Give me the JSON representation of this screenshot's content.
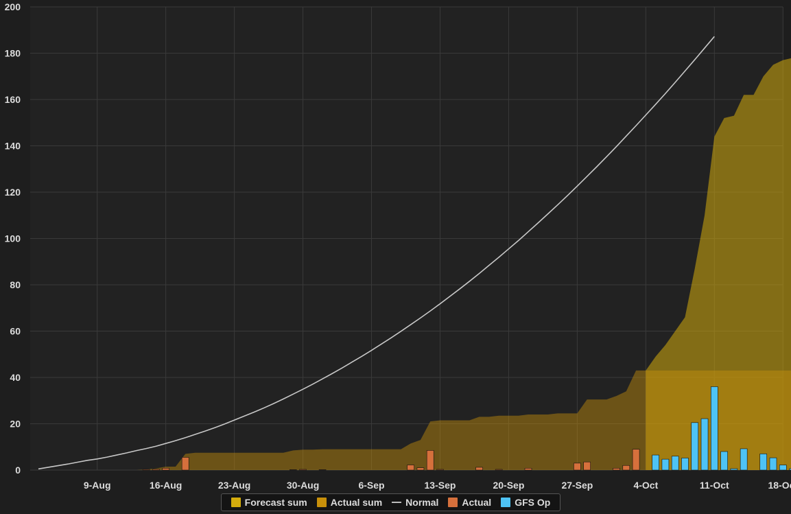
{
  "chart_data": {
    "type": "bar+area+line",
    "x_dates": [
      "Aug 3",
      "Aug 4",
      "Aug 5",
      "Aug 6",
      "Aug 7",
      "Aug 8",
      "Aug 9",
      "Aug 10",
      "Aug 11",
      "Aug 12",
      "Aug 13",
      "Aug 14",
      "Aug 15",
      "Aug 16",
      "Aug 17",
      "Aug 18",
      "Aug 19",
      "Aug 20",
      "Aug 21",
      "Aug 22",
      "Aug 23",
      "Aug 24",
      "Aug 25",
      "Aug 26",
      "Aug 27",
      "Aug 28",
      "Aug 29",
      "Aug 30",
      "Aug 31",
      "Sep 1",
      "Sep 2",
      "Sep 3",
      "Sep 4",
      "Sep 5",
      "Sep 6",
      "Sep 7",
      "Sep 8",
      "Sep 9",
      "Sep 10",
      "Sep 11",
      "Sep 12",
      "Sep 13",
      "Sep 14",
      "Sep 15",
      "Sep 16",
      "Sep 17",
      "Sep 18",
      "Sep 19",
      "Sep 20",
      "Sep 21",
      "Sep 22",
      "Sep 23",
      "Sep 24",
      "Sep 25",
      "Sep 26",
      "Sep 27",
      "Sep 28",
      "Sep 29",
      "Sep 30",
      "Oct 1",
      "Oct 2",
      "Oct 3",
      "Oct 4",
      "Oct 5",
      "Oct 6",
      "Oct 7",
      "Oct 8",
      "Oct 9",
      "Oct 10",
      "Oct 11",
      "Oct 12",
      "Oct 13",
      "Oct 14",
      "Oct 15",
      "Oct 16",
      "Oct 17",
      "Oct 18",
      "Oct 19"
    ],
    "x_tick_labels": [
      "9-Aug",
      "16-Aug",
      "23-Aug",
      "30-Aug",
      "6-Sep",
      "13-Sep",
      "20-Sep",
      "27-Sep",
      "4-Oct",
      "11-Oct",
      "18-Oct"
    ],
    "y_ticks": [
      0,
      20,
      40,
      60,
      80,
      100,
      120,
      140,
      160,
      180,
      200
    ],
    "ylim": [
      0,
      200
    ],
    "grid": true,
    "legend_position": "bottom-center",
    "series": [
      {
        "name": "Forecast sum",
        "kind": "area",
        "color": "#d4ac0d",
        "values": [
          null,
          null,
          null,
          null,
          null,
          null,
          null,
          null,
          null,
          null,
          null,
          null,
          null,
          null,
          null,
          null,
          null,
          null,
          null,
          null,
          null,
          null,
          null,
          null,
          null,
          null,
          null,
          null,
          null,
          null,
          null,
          null,
          null,
          null,
          null,
          null,
          null,
          null,
          null,
          null,
          null,
          null,
          null,
          null,
          null,
          null,
          null,
          null,
          null,
          null,
          null,
          null,
          null,
          null,
          null,
          null,
          null,
          null,
          null,
          null,
          null,
          null,
          43,
          49,
          54,
          60,
          66,
          87,
          110,
          144,
          152,
          153,
          162,
          162,
          170,
          175,
          177,
          178
        ]
      },
      {
        "name": "Actual sum",
        "kind": "area",
        "color": "#c8900a",
        "values": [
          0,
          0,
          0,
          0,
          0,
          0,
          0,
          0,
          0,
          0,
          0,
          0.3,
          0.7,
          1.5,
          1.5,
          7,
          7.5,
          7.5,
          7.5,
          7.5,
          7.5,
          7.5,
          7.5,
          7.5,
          7.5,
          7.5,
          8.5,
          8.8,
          8.8,
          9,
          9,
          9,
          9,
          9,
          9,
          9,
          9,
          9,
          11.5,
          13,
          21,
          21.5,
          21.5,
          21.5,
          21.5,
          23,
          23,
          23.5,
          23.5,
          23.5,
          24,
          24,
          24,
          24.5,
          24.5,
          24.5,
          30.5,
          30.5,
          30.5,
          32,
          34,
          43,
          43,
          43,
          43,
          43,
          43,
          43,
          43,
          43,
          43,
          43,
          43,
          43,
          43,
          43,
          43,
          43
        ]
      },
      {
        "name": "Normal",
        "kind": "line",
        "color": "#c8c8c8",
        "values": [
          0.5,
          1.2,
          1.9,
          2.6,
          3.4,
          4.2,
          4.8,
          5.6,
          6.5,
          7.4,
          8.4,
          9.3,
          10.3,
          11.5,
          12.7,
          14,
          15.4,
          16.8,
          18.3,
          19.9,
          21.6,
          23.3,
          25,
          26.8,
          28.7,
          30.7,
          32.8,
          34.9,
          37.1,
          39.4,
          41.7,
          44.1,
          46.6,
          49.1,
          51.7,
          54.4,
          57.1,
          59.9,
          62.8,
          65.7,
          68.7,
          71.8,
          75,
          78.2,
          81.5,
          84.9,
          88.4,
          91.9,
          95.5,
          99.1,
          102.9,
          106.7,
          110.6,
          114.5,
          118.5,
          122.6,
          126.8,
          131,
          135.3,
          139.7,
          144.2,
          148.7,
          153.3,
          157.9,
          162.6,
          167.4,
          172.3,
          177.2,
          182.2,
          187.2
        ]
      },
      {
        "name": "Actual",
        "kind": "bar",
        "color": "#d6703c",
        "values": [
          0,
          0,
          0,
          0,
          0,
          0,
          0,
          0,
          0,
          0,
          0,
          0.3,
          0.4,
          0.8,
          0,
          5.5,
          0,
          0,
          0,
          0,
          0,
          0,
          0,
          0,
          0,
          0,
          0.2,
          0.3,
          0,
          0.2,
          0,
          0,
          0,
          0,
          0,
          0,
          0,
          0,
          2.2,
          1,
          8.5,
          0.3,
          0,
          0,
          0,
          1.2,
          0,
          0.3,
          0,
          0,
          0.8,
          0,
          0,
          0,
          0,
          3,
          3.5,
          0,
          0,
          0.8,
          2,
          9,
          0
        ]
      },
      {
        "name": "GFS Op",
        "kind": "bar",
        "color": "#4ec3f5",
        "values": [
          null,
          null,
          null,
          null,
          null,
          null,
          null,
          null,
          null,
          null,
          null,
          null,
          null,
          null,
          null,
          null,
          null,
          null,
          null,
          null,
          null,
          null,
          null,
          null,
          null,
          null,
          null,
          null,
          null,
          null,
          null,
          null,
          null,
          null,
          null,
          null,
          null,
          null,
          null,
          null,
          null,
          null,
          null,
          null,
          null,
          null,
          null,
          null,
          null,
          null,
          null,
          null,
          null,
          null,
          null,
          null,
          null,
          null,
          null,
          null,
          null,
          null,
          0,
          6.5,
          4.7,
          6,
          5.2,
          20.5,
          22.2,
          36,
          8,
          0.6,
          9.2,
          0,
          7,
          5.3,
          2.2,
          0.6
        ]
      }
    ]
  },
  "legend": {
    "forecast_sum": "Forecast sum",
    "actual_sum": "Actual sum",
    "normal": "Normal",
    "actual": "Actual",
    "gfs_op": "GFS Op"
  }
}
